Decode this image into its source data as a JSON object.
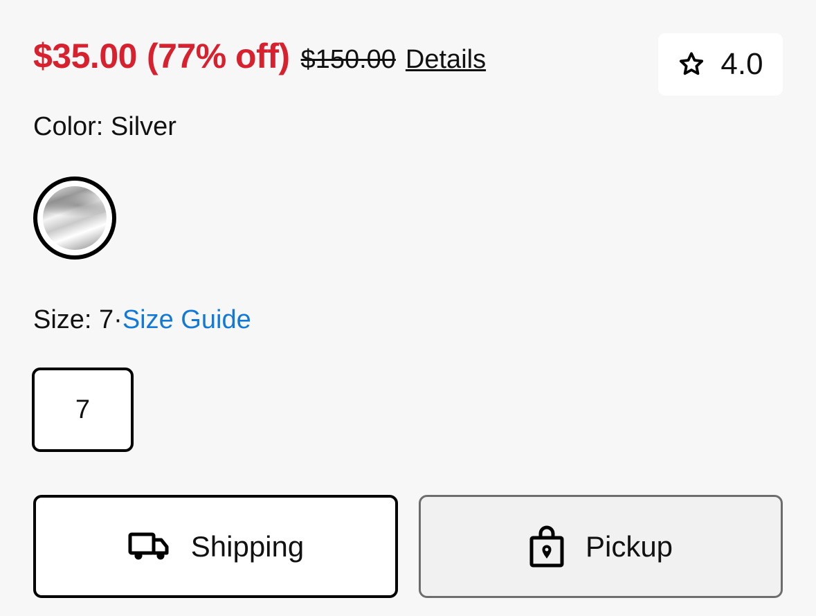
{
  "pricing": {
    "sale_price": "$35.00",
    "discount": "(77% off)",
    "original_price": "$150.00",
    "details_link": "Details"
  },
  "rating": {
    "icon": "star-outline-icon",
    "value": "4.0"
  },
  "color": {
    "label": "Color: Silver",
    "swatch_name": "Silver"
  },
  "size": {
    "label": "Size: 7·",
    "guide_link": "Size Guide",
    "options": [
      "7"
    ]
  },
  "fulfillment": {
    "shipping": {
      "label": "Shipping",
      "icon": "truck-icon"
    },
    "pickup": {
      "label": "Pickup",
      "icon": "shopping-bag-location-icon"
    }
  },
  "colors": {
    "sale_red": "#d7212e",
    "link_blue": "#1279d6",
    "background": "#f7f7f7"
  }
}
